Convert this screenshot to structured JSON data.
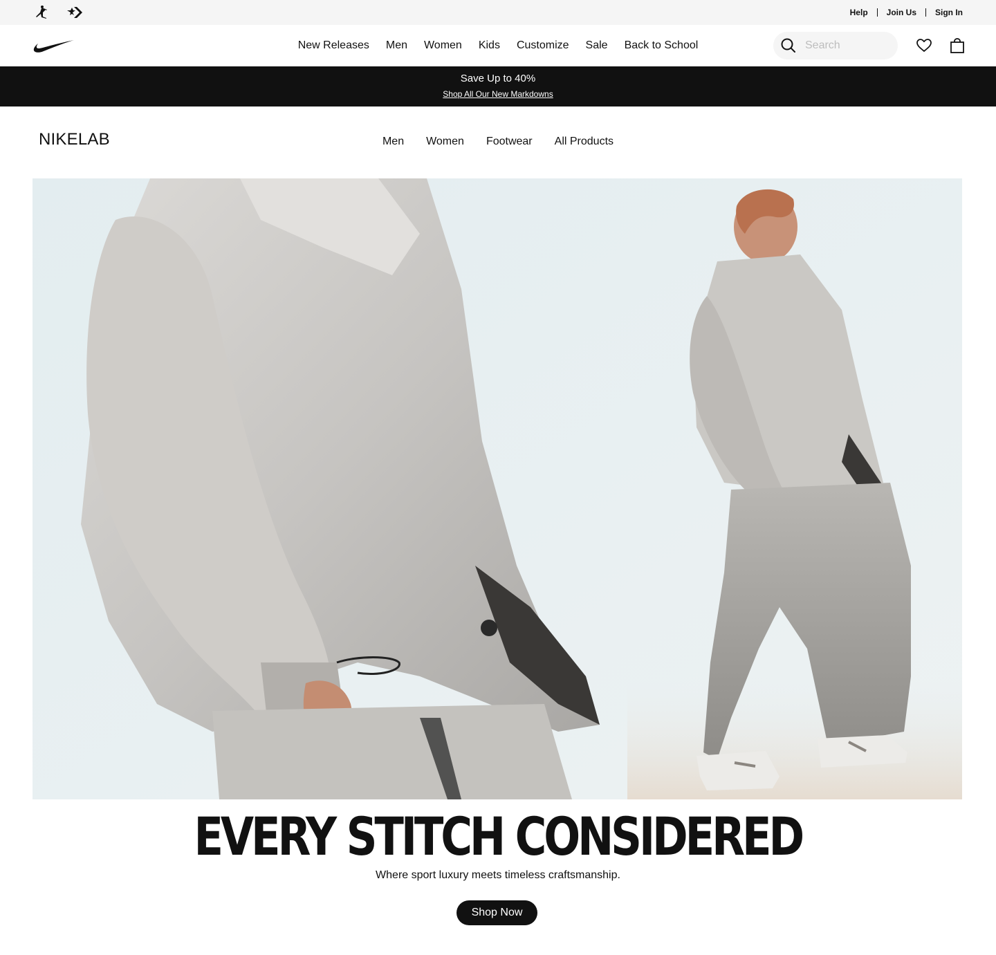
{
  "utility": {
    "brands": [
      {
        "name": "jordan-icon"
      },
      {
        "name": "converse-icon"
      }
    ],
    "links": [
      "Help",
      "Join Us",
      "Sign In"
    ]
  },
  "header": {
    "logo": "nike-swoosh-icon",
    "nav": [
      "New Releases",
      "Men",
      "Women",
      "Kids",
      "Customize",
      "Sale",
      "Back to School"
    ],
    "search": {
      "placeholder": "Search",
      "value": ""
    },
    "icons": [
      "heart-icon",
      "bag-icon"
    ]
  },
  "promo": {
    "title": "Save Up to 40%",
    "link": "Shop All Our New Markdowns"
  },
  "subheader": {
    "title": "NIKELAB",
    "nav": [
      "Men",
      "Women",
      "Footwear",
      "All Products"
    ]
  },
  "hero": {
    "headline": "EVERY STITCH CONSIDERED",
    "subtext": "Where sport luxury meets timeless craftsmanship.",
    "cta": "Shop Now"
  },
  "colors": {
    "ink": "#111111",
    "utility_bg": "#f5f5f5",
    "hero_bg": "#e7eff2",
    "garment": "#c9c7c4"
  }
}
